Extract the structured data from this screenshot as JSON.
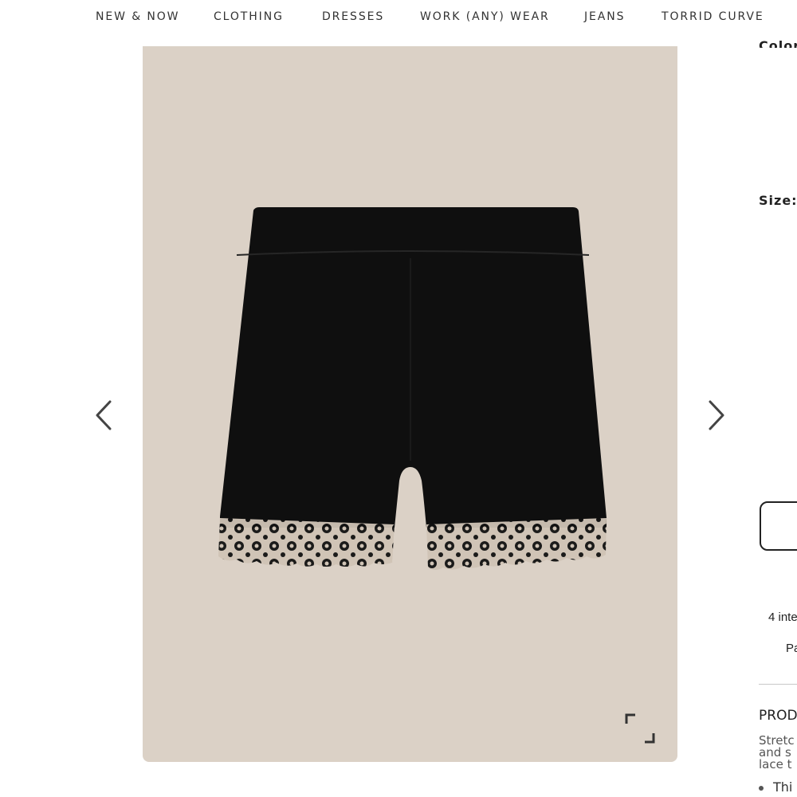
{
  "nav": {
    "items": [
      {
        "label": "NEW & NOW"
      },
      {
        "label": "CLOTHING"
      },
      {
        "label": "DRESSES"
      },
      {
        "label": "WORK (ANY) WEAR"
      },
      {
        "label": "JEANS"
      },
      {
        "label": "TORRID CURVE"
      }
    ]
  },
  "gallery": {
    "prev_icon": "chevron-left-icon",
    "next_icon": "chevron-right-icon",
    "expand_icon": "expand-icon",
    "background_color": "#dbd1c6",
    "product_color": "#0f0f0f"
  },
  "sidebar": {
    "color_label": "Color:",
    "size_label": "Size:",
    "installments_text": "4 inte",
    "pay_link": "Pa",
    "details_heading": "PROD",
    "description_lines": [
      "Stretc",
      "and s",
      "lace t"
    ],
    "bullet_text": "Thi"
  }
}
